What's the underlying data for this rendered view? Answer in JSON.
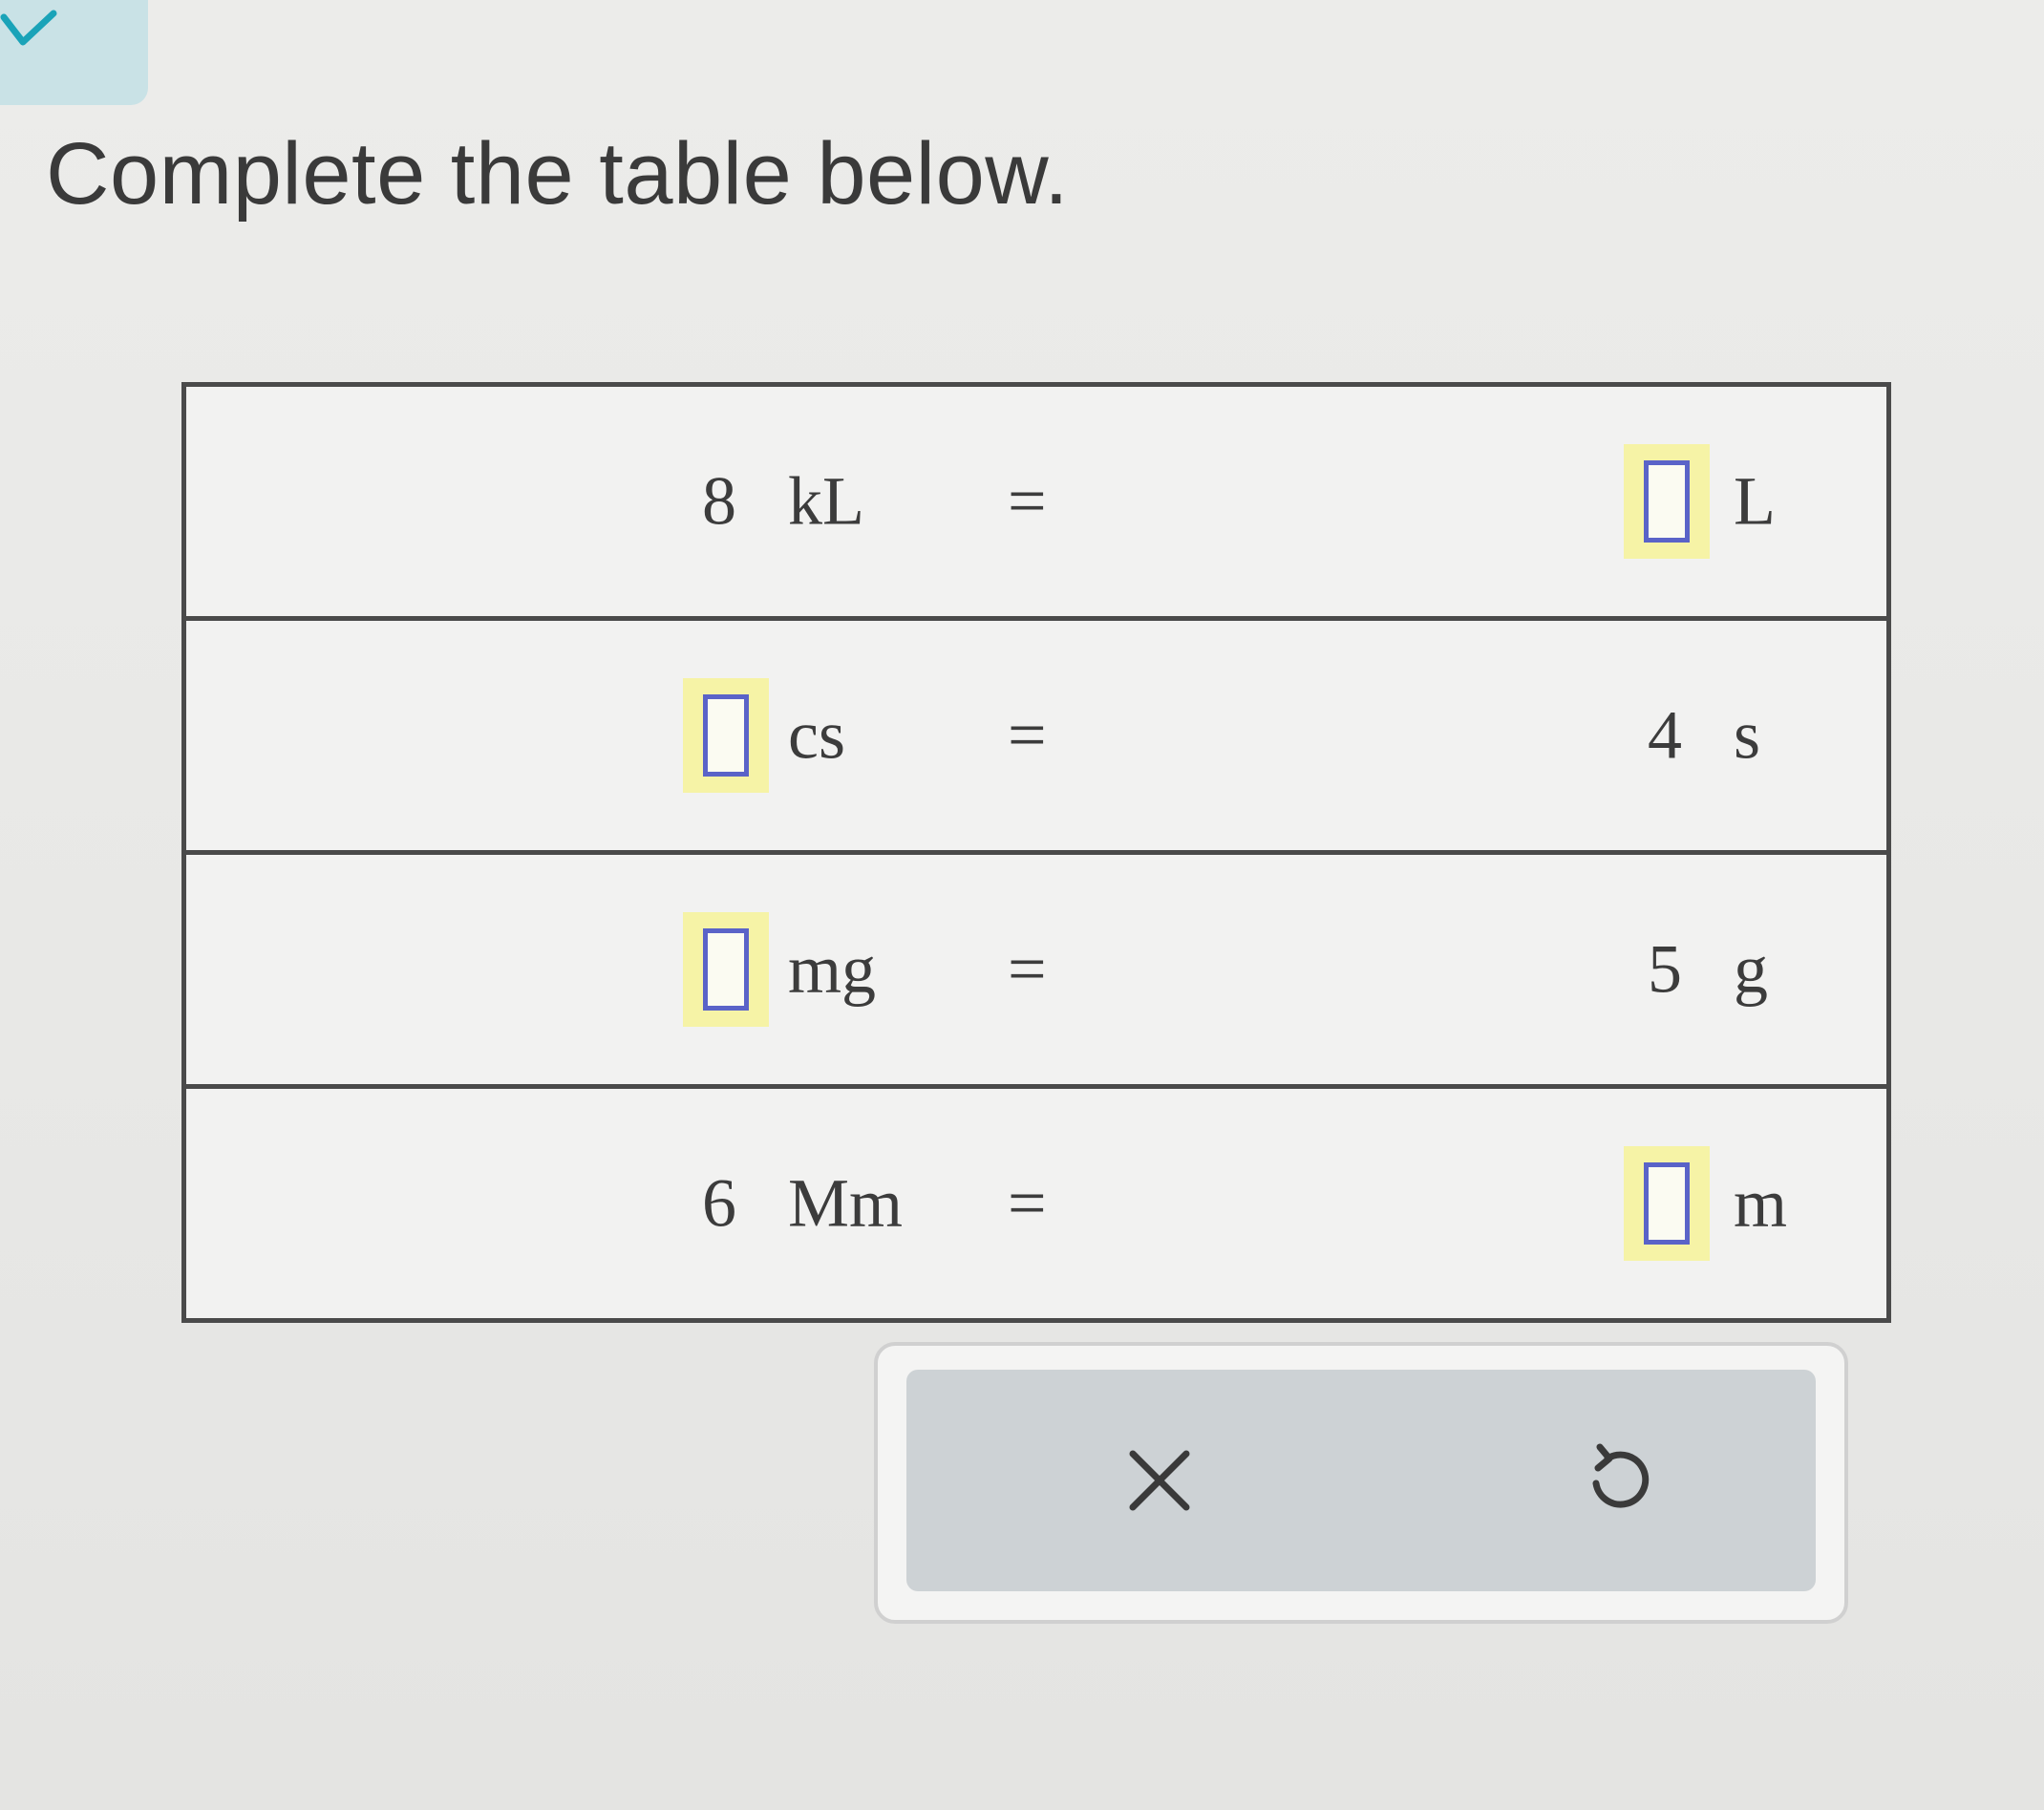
{
  "prompt": "Complete the table below.",
  "icons": {
    "collapse": "chevron-down-icon",
    "clear": "close-icon",
    "undo": "undo-icon"
  },
  "colors": {
    "accent_tab": "#c9e2e6",
    "answer_highlight": "#f6f3a6",
    "answer_border": "#5a63c8"
  },
  "table": {
    "rows": [
      {
        "left_value": "8",
        "left_unit": "kL",
        "equals": "=",
        "right_value": "",
        "right_unit": "L"
      },
      {
        "left_value": "",
        "left_unit": "cs",
        "equals": "=",
        "right_value": "4",
        "right_unit": "s"
      },
      {
        "left_value": "",
        "left_unit": "mg",
        "equals": "=",
        "right_value": "5",
        "right_unit": "g"
      },
      {
        "left_value": "6",
        "left_unit": "Mm",
        "equals": "=",
        "right_value": "",
        "right_unit": "m"
      }
    ]
  }
}
